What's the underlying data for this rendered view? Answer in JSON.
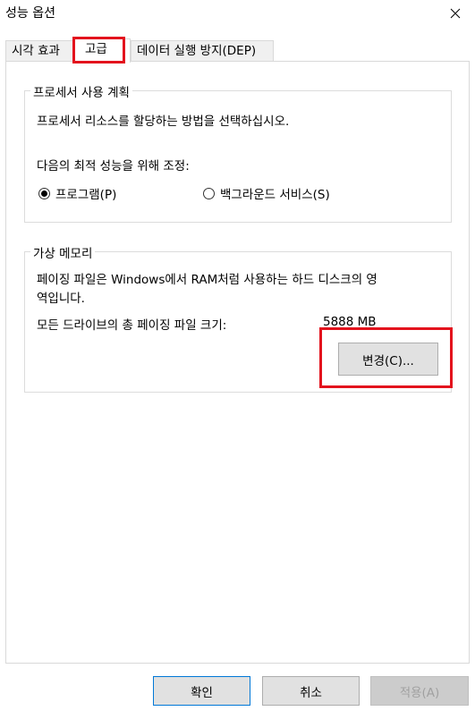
{
  "window": {
    "title": "성능 옵션"
  },
  "tabs": [
    {
      "label": "시각 효과",
      "active": false
    },
    {
      "label": "고급",
      "active": true
    },
    {
      "label": "데이터 실행 방지(DEP)",
      "active": false
    }
  ],
  "processor_scheduling": {
    "legend": "프로세서 사용 계획",
    "description": "프로세서 리소스를 할당하는 방법을 선택하십시오.",
    "adjust_label": "다음의 최적 성능을 위해 조정:",
    "options": [
      {
        "label": "프로그램(P)",
        "checked": true
      },
      {
        "label": "백그라운드 서비스(S)",
        "checked": false
      }
    ]
  },
  "virtual_memory": {
    "legend": "가상 메모리",
    "description_line1": "페이징 파일은 Windows에서 RAM처럼 사용하는 하드 디스크의 영",
    "description_line2": "역입니다.",
    "total_label": "모든 드라이브의 총 페이징 파일 크기:",
    "total_value": "5888 MB",
    "change_button": "변경(C)..."
  },
  "footer": {
    "ok": "확인",
    "cancel": "취소",
    "apply": "적용(A)"
  },
  "colors": {
    "highlight": "#e3131d",
    "default_button_border": "#0078d7"
  },
  "icons": {
    "close": "close-icon"
  }
}
